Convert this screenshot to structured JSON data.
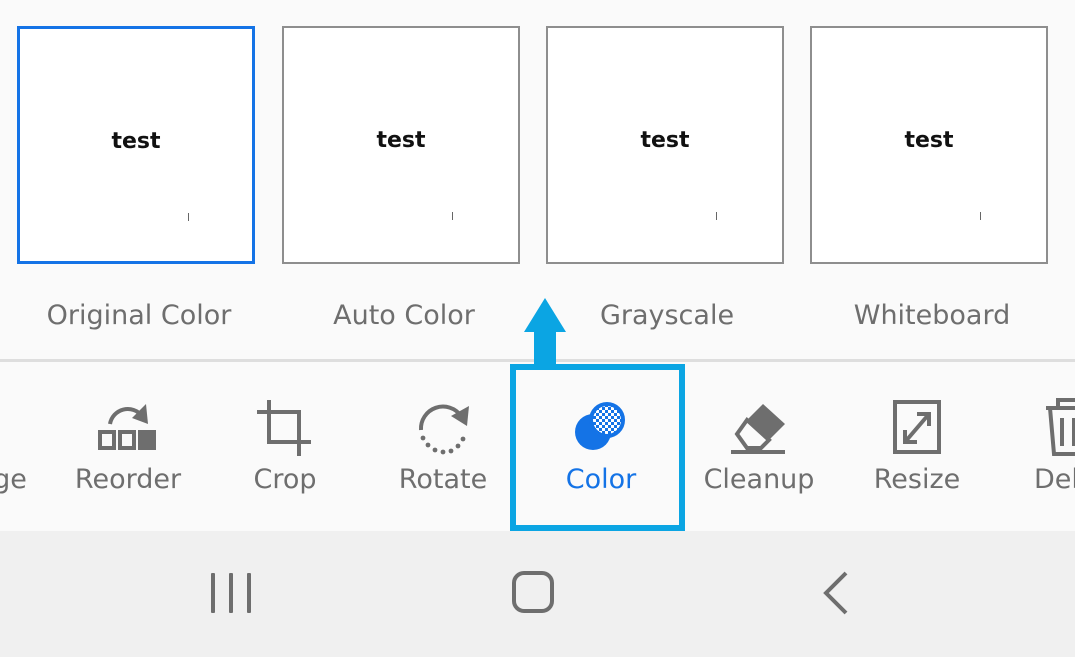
{
  "filters": [
    {
      "label": "Original Color",
      "preview_text": "test",
      "selected": true
    },
    {
      "label": "Auto Color",
      "preview_text": "test",
      "selected": false
    },
    {
      "label": "Grayscale",
      "preview_text": "test",
      "selected": false
    },
    {
      "label": "Whiteboard",
      "preview_text": "test",
      "selected": false
    }
  ],
  "toolbar": {
    "partial_left_label": "ge",
    "reorder_label": "Reorder",
    "crop_label": "Crop",
    "rotate_label": "Rotate",
    "color_label": "Color",
    "cleanup_label": "Cleanup",
    "resize_label": "Resize",
    "partial_right_label": "Del",
    "active_tool": "Color"
  },
  "icons": {
    "reorder": "reorder-icon",
    "crop": "crop-icon",
    "rotate": "rotate-icon",
    "color": "color-icon",
    "cleanup": "eraser-icon",
    "resize": "resize-icon",
    "delete": "trash-icon"
  },
  "colors": {
    "accent": "#1473e6",
    "highlight": "#0ba5e3",
    "icon_gray": "#6e6e6e"
  },
  "nav": {
    "recents": "recent-apps-icon",
    "home": "home-icon",
    "back": "back-icon"
  }
}
